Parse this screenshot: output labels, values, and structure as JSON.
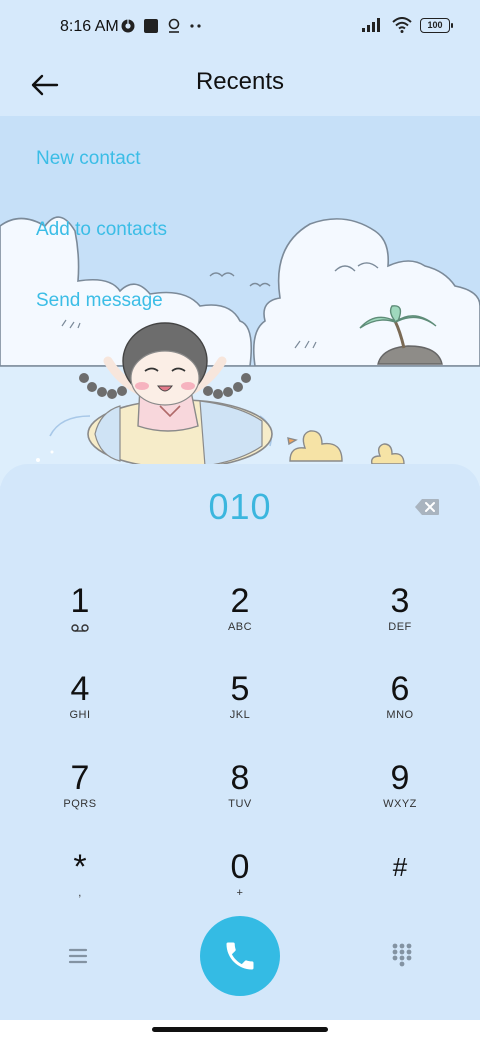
{
  "status_bar": {
    "time": "8:16 AM",
    "battery": "100",
    "icons": [
      "chrome-icon",
      "square-icon",
      "location-icon",
      "more-dots-icon",
      "signal-icon",
      "wifi-icon",
      "battery-icon"
    ]
  },
  "header": {
    "title": "Recents",
    "back_icon": "arrow-left-icon"
  },
  "actions": {
    "new_contact": "New contact",
    "add_to_contacts": "Add to contacts",
    "send_message": "Send message"
  },
  "dialer": {
    "number": "010",
    "keys": [
      {
        "digit": "1",
        "sub": ""
      },
      {
        "digit": "2",
        "sub": "ABC"
      },
      {
        "digit": "3",
        "sub": "DEF"
      },
      {
        "digit": "4",
        "sub": "GHI"
      },
      {
        "digit": "5",
        "sub": "JKL"
      },
      {
        "digit": "6",
        "sub": "MNO"
      },
      {
        "digit": "7",
        "sub": "PQRS"
      },
      {
        "digit": "8",
        "sub": "TUV"
      },
      {
        "digit": "9",
        "sub": "WXYZ"
      },
      {
        "digit": "*",
        "sub": ","
      },
      {
        "digit": "0",
        "sub": "+"
      },
      {
        "digit": "#",
        "sub": ""
      }
    ]
  },
  "colors": {
    "accent": "#3bbde6",
    "call_button": "#34bbe4",
    "background": "#d6e9fb"
  }
}
